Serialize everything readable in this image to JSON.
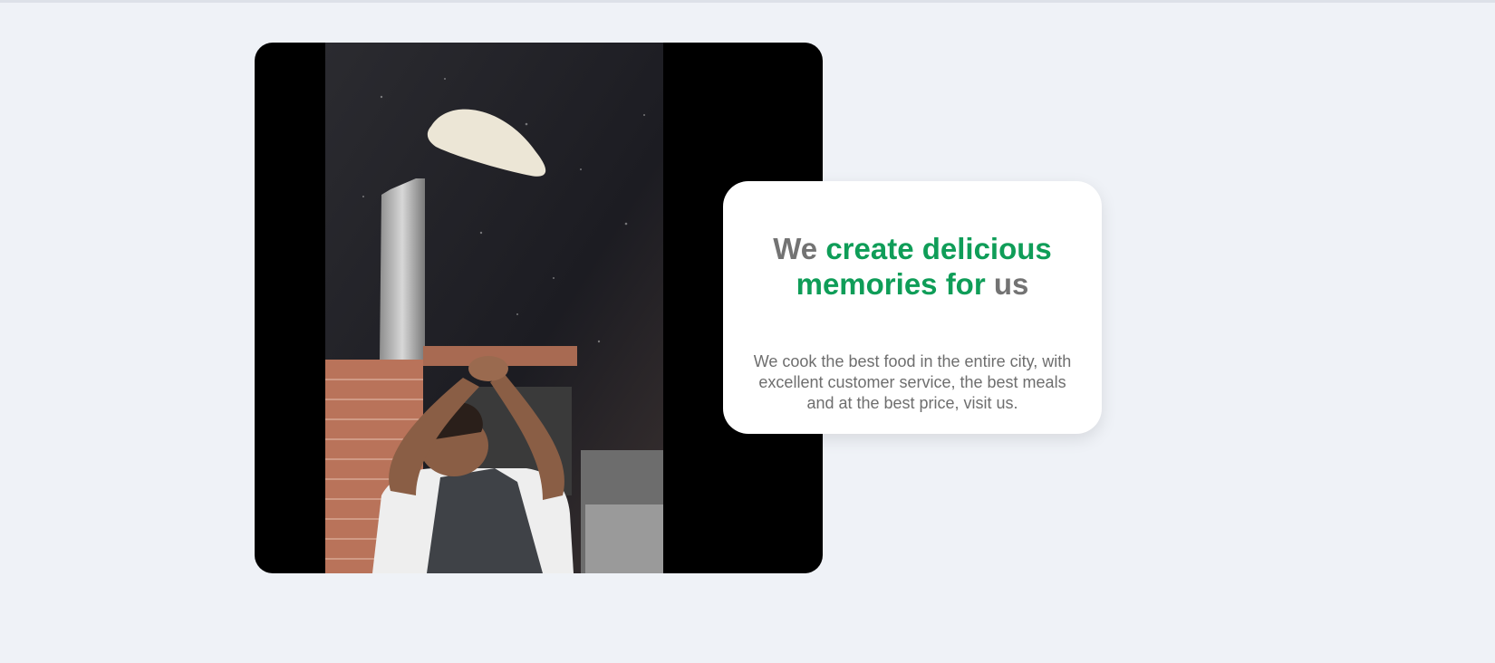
{
  "hero": {
    "video_alt": "Chef tossing pizza dough in the air inside a restaurant kitchen",
    "headline": {
      "part1": "We",
      "part2": "create delicious",
      "part3": "memories for",
      "part4": "us"
    },
    "description": "We cook the best food in the entire city, with excellent customer service, the best meals and at the best price, visit us.",
    "colors": {
      "accent_green": "#0f9d58",
      "text_gray": "#737373",
      "background": "#eff2f7"
    }
  }
}
